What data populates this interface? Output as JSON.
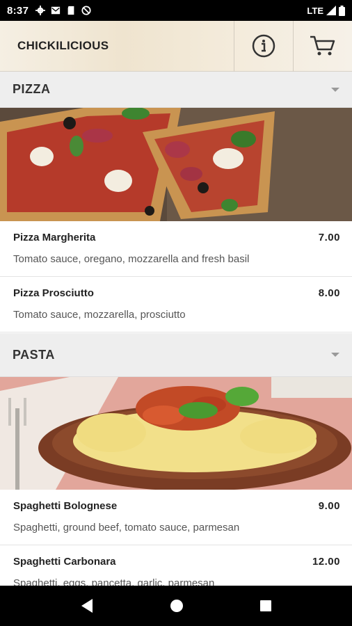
{
  "status": {
    "time": "8:37",
    "network": "LTE"
  },
  "header": {
    "brand": "CHICKILICIOUS"
  },
  "sections": [
    {
      "title": "PIZZA",
      "items": [
        {
          "name": "Pizza Margherita",
          "price": "7.00",
          "desc": "Tomato sauce, oregano, mozzarella and fresh basil"
        },
        {
          "name": "Pizza Prosciutto",
          "price": "8.00",
          "desc": "Tomato sauce, mozzarella, prosciutto"
        }
      ]
    },
    {
      "title": "PASTA",
      "items": [
        {
          "name": "Spaghetti Bolognese",
          "price": "9.00",
          "desc": "Spaghetti, ground beef, tomato sauce, parmesan"
        },
        {
          "name": "Spaghetti Carbonara",
          "price": "12.00",
          "desc": "Spaghetti, eggs, pancetta, garlic, parmesan"
        }
      ]
    }
  ]
}
